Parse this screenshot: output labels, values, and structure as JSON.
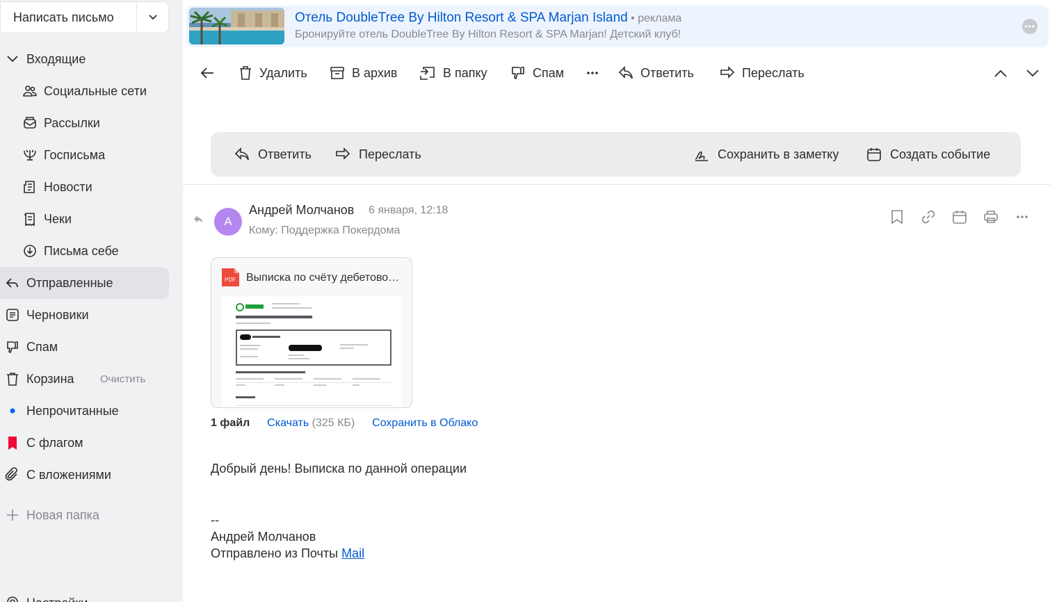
{
  "compose": {
    "label": "Написать письмо"
  },
  "sidebar": {
    "items": [
      {
        "label": "Входящие",
        "icon": "chevron-down-icon"
      },
      {
        "label": "Социальные сети",
        "icon": "people-icon"
      },
      {
        "label": "Рассылки",
        "icon": "newsletter-icon"
      },
      {
        "label": "Госписьма",
        "icon": "gov-emblem-icon"
      },
      {
        "label": "Новости",
        "icon": "news-icon"
      },
      {
        "label": "Чеки",
        "icon": "receipt-icon"
      },
      {
        "label": "Письма себе",
        "icon": "self-mail-icon"
      },
      {
        "label": "Отправленные",
        "icon": "sent-icon"
      },
      {
        "label": "Черновики",
        "icon": "drafts-icon"
      },
      {
        "label": "Спам",
        "icon": "spam-icon"
      },
      {
        "label": "Корзина",
        "icon": "trash-icon",
        "extra": "Очистить"
      },
      {
        "label": "Непрочитанные",
        "icon": "unread-dot-icon"
      },
      {
        "label": "С флагом",
        "icon": "flag-icon"
      },
      {
        "label": "С вложениями",
        "icon": "paperclip-icon"
      },
      {
        "label": "Новая папка",
        "icon": "plus-icon"
      }
    ],
    "bottom_label": "Настройки"
  },
  "ad": {
    "title": "Отель DoubleTree By Hilton Resort & SPA Marjan Island",
    "tag": " • реклама",
    "subtitle": "Бронируйте отель DoubleTree By Hilton Resort & SPA Marjan! Детский клуб!"
  },
  "toolbar": {
    "delete": "Удалить",
    "archive": "В архив",
    "to_folder": "В папку",
    "spam": "Спам",
    "reply": "Ответить",
    "forward": "Переслать"
  },
  "actionbar": {
    "reply": "Ответить",
    "forward": "Переслать",
    "save_note": "Сохранить в заметку",
    "create_event": "Создать событие"
  },
  "message": {
    "avatar_letter": "А",
    "sender": "Андрей Молчанов",
    "date": "6 января, 12:18",
    "to": "Кому: Поддержка Покердома",
    "attachment_name": "Выписка по счёту дебетовой карты",
    "pdf_label": "PDF",
    "files_count": "1 файл",
    "download": "Скачать",
    "size": "(325 КБ)",
    "save_cloud": "Сохранить в Облако",
    "body": "Добрый день! Выписка по данной операции",
    "sig_dash": "--",
    "sig_name": "Андрей Молчанов",
    "sig_sent": "Отправлено из Почты ",
    "sig_link": "Mail"
  },
  "colors": {
    "accent": "#005bd1",
    "avatar": "#b486f0",
    "flag": "#ed0a34",
    "unread": "#005ff9"
  }
}
